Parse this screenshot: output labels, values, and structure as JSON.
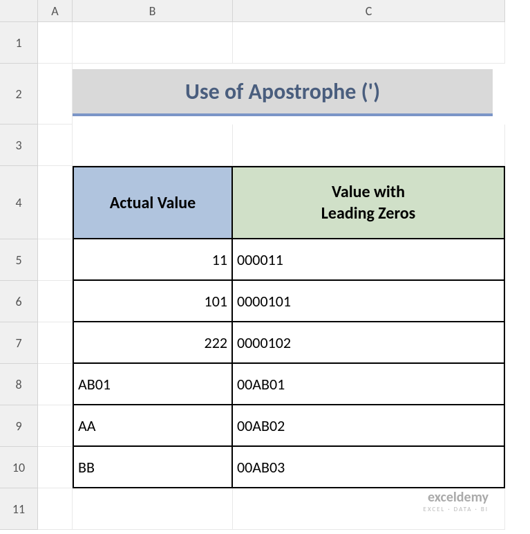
{
  "columns": [
    "A",
    "B",
    "C"
  ],
  "rows": [
    "1",
    "2",
    "3",
    "4",
    "5",
    "6",
    "7",
    "8",
    "9",
    "10",
    "11"
  ],
  "title": "Use of Apostrophe (')",
  "headers": {
    "actual": "Actual Value",
    "zeros_line1": "Value with",
    "zeros_line2": "Leading Zeros"
  },
  "data": [
    {
      "actual": "11",
      "zeros": "000011",
      "actual_align": "right"
    },
    {
      "actual": "101",
      "zeros": "0000101",
      "actual_align": "right"
    },
    {
      "actual": "222",
      "zeros": "0000102",
      "actual_align": "right"
    },
    {
      "actual": "AB01",
      "zeros": "00AB01",
      "actual_align": "left"
    },
    {
      "actual": "AA",
      "zeros": "00AB02",
      "actual_align": "left"
    },
    {
      "actual": "BB",
      "zeros": "00AB03",
      "actual_align": "left"
    }
  ],
  "watermark": {
    "brand": "exceldemy",
    "sub": "EXCEL · DATA · BI"
  },
  "chart_data": {
    "type": "table",
    "title": "Use of Apostrophe (')",
    "columns": [
      "Actual Value",
      "Value with Leading Zeros"
    ],
    "rows": [
      [
        "11",
        "000011"
      ],
      [
        "101",
        "0000101"
      ],
      [
        "222",
        "0000102"
      ],
      [
        "AB01",
        "00AB01"
      ],
      [
        "AA",
        "00AB02"
      ],
      [
        "BB",
        "00AB03"
      ]
    ]
  }
}
